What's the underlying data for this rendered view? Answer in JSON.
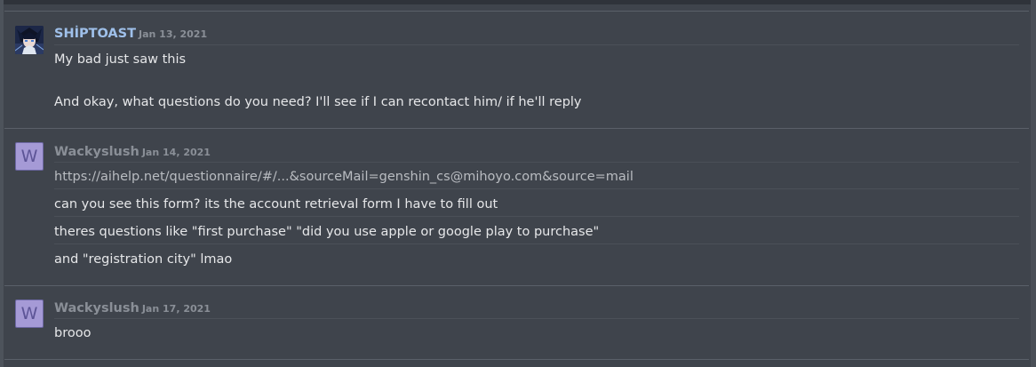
{
  "colors": {
    "background": "#3f444c",
    "divider": "#5a6069",
    "message_text": "#e6e7e9",
    "date_text": "#8a8f97",
    "author_siptoast": "#9fc0ea",
    "author_wackyslush": "#8a8f97",
    "avatar_letter_bg": "#a59ad6"
  },
  "messages": [
    {
      "author": "SHİPTOAST",
      "date": "Jan 13, 2021",
      "avatar": "anime-character-avatar",
      "lines": [
        "My bad just saw this",
        "And okay, what questions do you need? I'll see if I can recontact him/ if he'll reply"
      ]
    },
    {
      "author": "Wackyslush",
      "date": "Jan 14, 2021",
      "avatar_letter": "W",
      "lines": [
        "https://aihelp.net/questionnaire/#/...&sourceMail=genshin_cs@mihoyo.com&source=mail",
        "can you see this form? its the account retrieval form I have to fill out",
        "theres questions like \"first purchase\" \"did you use apple or google play to purchase\"",
        "and \"registration city\" lmao"
      ]
    },
    {
      "author": "Wackyslush",
      "date": "Jan 17, 2021",
      "avatar_letter": "W",
      "lines": [
        "brooo"
      ]
    }
  ]
}
